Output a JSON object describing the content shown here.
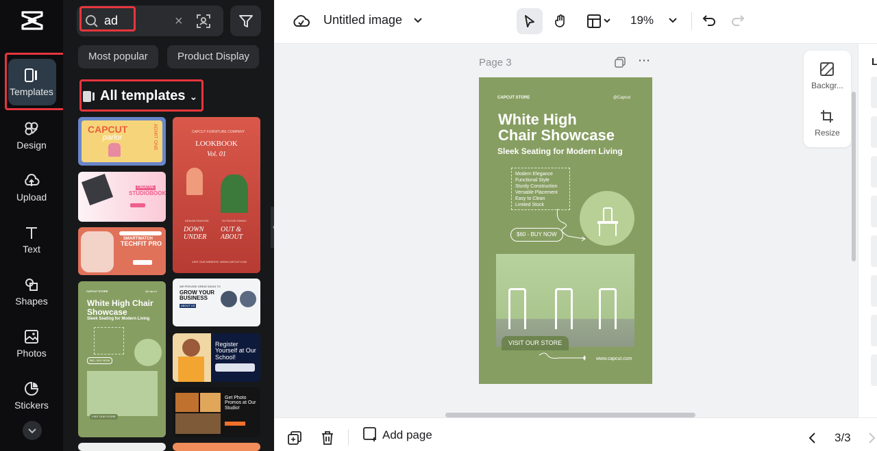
{
  "rail": {
    "items": [
      {
        "label": "Templates",
        "icon": "templates-icon",
        "active": true
      },
      {
        "label": "Design",
        "icon": "design-icon"
      },
      {
        "label": "Upload",
        "icon": "upload-icon"
      },
      {
        "label": "Text",
        "icon": "text-icon"
      },
      {
        "label": "Shapes",
        "icon": "shapes-icon"
      },
      {
        "label": "Photos",
        "icon": "photos-icon"
      },
      {
        "label": "Stickers",
        "icon": "stickers-icon"
      }
    ]
  },
  "panel": {
    "search_value": "ad",
    "chips": [
      "Most popular",
      "Product Display"
    ],
    "all_templates": "All templates",
    "thumbs": {
      "capcut_parlor": {
        "brand": "CAPCUT",
        "sub": "parlor",
        "admit": "ADMIT ONE"
      },
      "lookbook": {
        "company": "CAPCUT FURNITURE COMPANY",
        "title": "LOOKBOOK",
        "vol": "Vol. 01",
        "left_small": "DESIGN FEATURE",
        "left_big": "DOWN UNDER",
        "right_small": "OUTDOOR DINING",
        "right_big": "OUT & ABOUT",
        "website": "VISIT OUR WEBSITE: WWW.CAPCUT.COM"
      },
      "studiobook": {
        "tag": "CREATIVE",
        "title": "STUDIOBOOK"
      },
      "techfit": {
        "tag": "SMARTWATCH",
        "title": "TECHFIT PRO"
      },
      "chair_mini": {
        "store": "CAPCUT STORE",
        "handle": "@Capcut",
        "title": "White High Chair Showcase",
        "subtitle": "Sleek Seating for Modern Living",
        "price": "$60 - BUY NOW",
        "visit": "VISIT OUR STORE"
      },
      "business": {
        "small": "WE PROVIDE GREAT IDEAS TO",
        "title": "GROW YOUR BUSINESS",
        "tag": "ABOUT US"
      },
      "school": {
        "title": "Register Yourself at Our School!"
      },
      "photo": {
        "title": "Get Photo Promos at Our Studio!"
      }
    }
  },
  "topbar": {
    "title": "Untitled image",
    "zoom": "19%"
  },
  "canvas": {
    "page_label": "Page 3",
    "design": {
      "store": "CAPCUT STORE",
      "handle": "@Capcut",
      "title_line1": "White High",
      "title_line2": "Chair Showcase",
      "subtitle": "Sleek Seating for Modern Living",
      "features": [
        "Modern Elegance",
        "Functional Style",
        "Sturdy Construction",
        "Versatile Placement",
        "Easy to Clean",
        "Limited Stock"
      ],
      "price_button": "$60 - BUY NOW",
      "visit_button": "VISIT OUR STORE",
      "website": "www.capcut.com"
    }
  },
  "floating_tools": {
    "background": "Backgr...",
    "resize": "Resize"
  },
  "right_strip_letter": "L",
  "bottombar": {
    "add_page": "Add page",
    "pager": "3/3"
  },
  "colors": {
    "accent_red": "#e8363d",
    "rail_bg": "#0d0d0f",
    "panel_bg": "#17181a",
    "design_green": "#879e62"
  }
}
